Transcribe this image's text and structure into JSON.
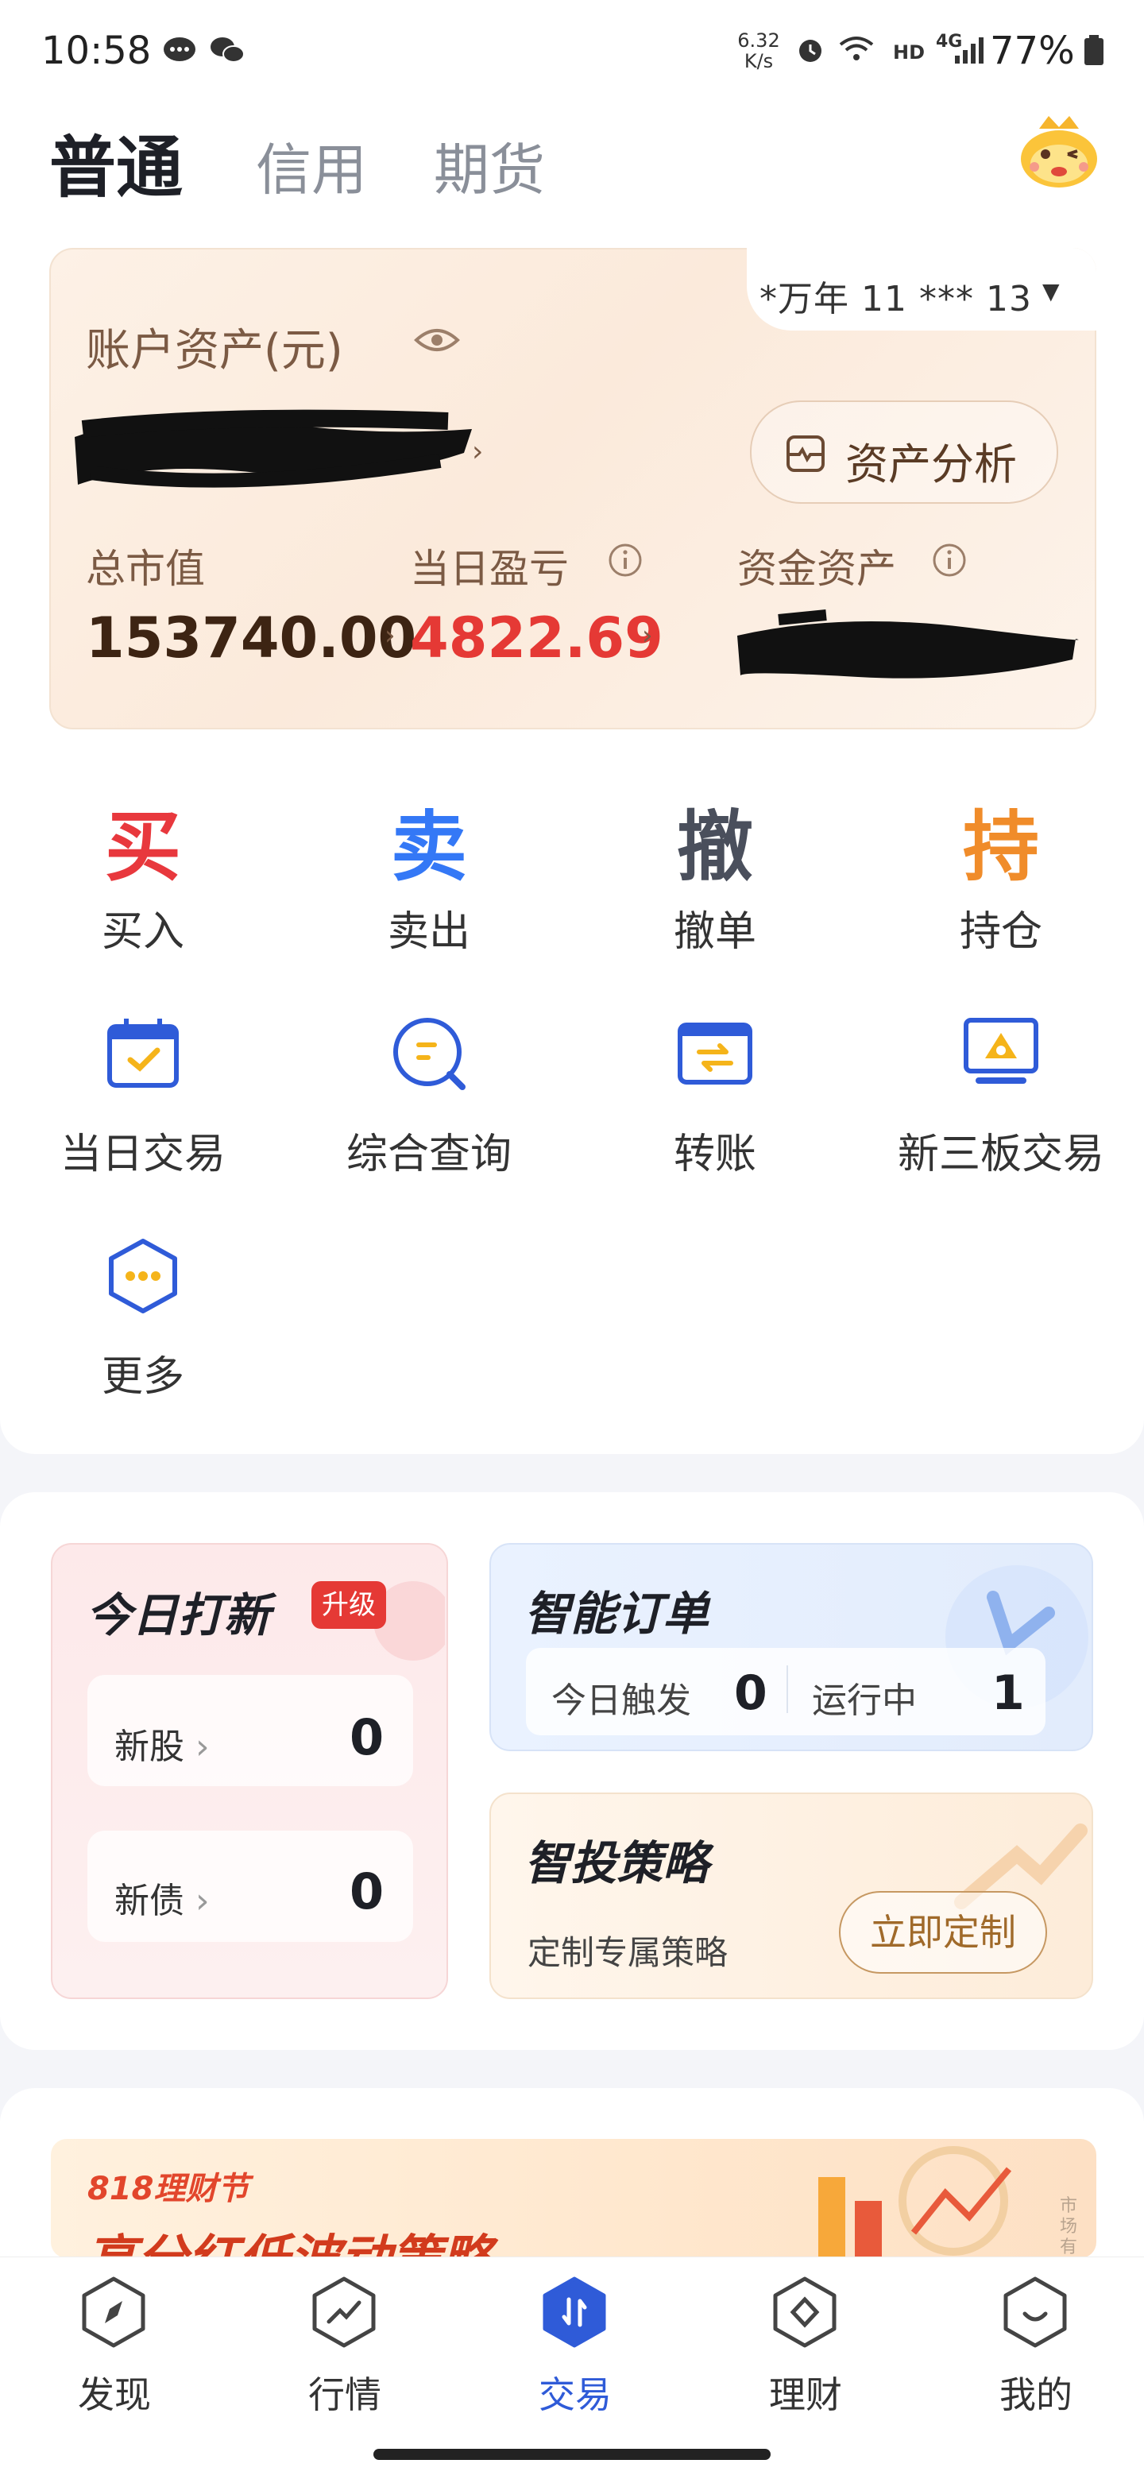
{
  "status_bar": {
    "time": "10:58",
    "net_speed_top": "6.32",
    "net_speed_bottom": "K/s",
    "signal_text": "HD",
    "network_type": "4G",
    "battery": "77%"
  },
  "tabs": [
    {
      "label": "普通",
      "active": true
    },
    {
      "label": "信用",
      "active": false
    },
    {
      "label": "期货",
      "active": false
    }
  ],
  "asset_card": {
    "account": "*万年 11 *** 13",
    "title": "账户资产(元)",
    "analysis_button": "资产分析",
    "market_value_label": "总市值",
    "market_value": "153740.00",
    "daily_pl_label": "当日盈亏",
    "daily_pl": "4822.69",
    "cash_label": "资金资产"
  },
  "quick_actions": [
    {
      "glyph": "买",
      "label": "买入",
      "color": "#e8383d"
    },
    {
      "glyph": "卖",
      "label": "卖出",
      "color": "#3478f6"
    },
    {
      "glyph": "撤",
      "label": "撤单",
      "color": "#4a4f5c"
    },
    {
      "glyph": "持",
      "label": "持仓",
      "color": "#f08c2a"
    }
  ],
  "functions": [
    {
      "label": "当日交易",
      "icon": "calendar-check-icon"
    },
    {
      "label": "综合查询",
      "icon": "search-query-icon"
    },
    {
      "label": "转账",
      "icon": "transfer-icon"
    },
    {
      "label": "新三板交易",
      "icon": "board-trade-icon"
    },
    {
      "label": "更多",
      "icon": "more-icon"
    }
  ],
  "ipo_card": {
    "title": "今日打新",
    "badge": "升级",
    "rows": [
      {
        "label": "新股",
        "value": "0"
      },
      {
        "label": "新债",
        "value": "0"
      }
    ]
  },
  "smart_order": {
    "title": "智能订单",
    "triggered_label": "今日触发",
    "triggered_value": "0",
    "running_label": "运行中",
    "running_value": "1"
  },
  "strategy": {
    "title": "智投策略",
    "subtitle": "定制专属策略",
    "button": "立即定制"
  },
  "promo": {
    "tag": "818理财节",
    "headline": "高分红低波动策略",
    "side_text": "市场有风险"
  },
  "bottom_nav": [
    {
      "label": "发现",
      "active": false
    },
    {
      "label": "行情",
      "active": false
    },
    {
      "label": "交易",
      "active": true
    },
    {
      "label": "理财",
      "active": false
    },
    {
      "label": "我的",
      "active": false
    }
  ],
  "colors": {
    "accent": "#2f5bd8",
    "loss_red": "#e53935",
    "brown_text": "#7b5a44"
  }
}
